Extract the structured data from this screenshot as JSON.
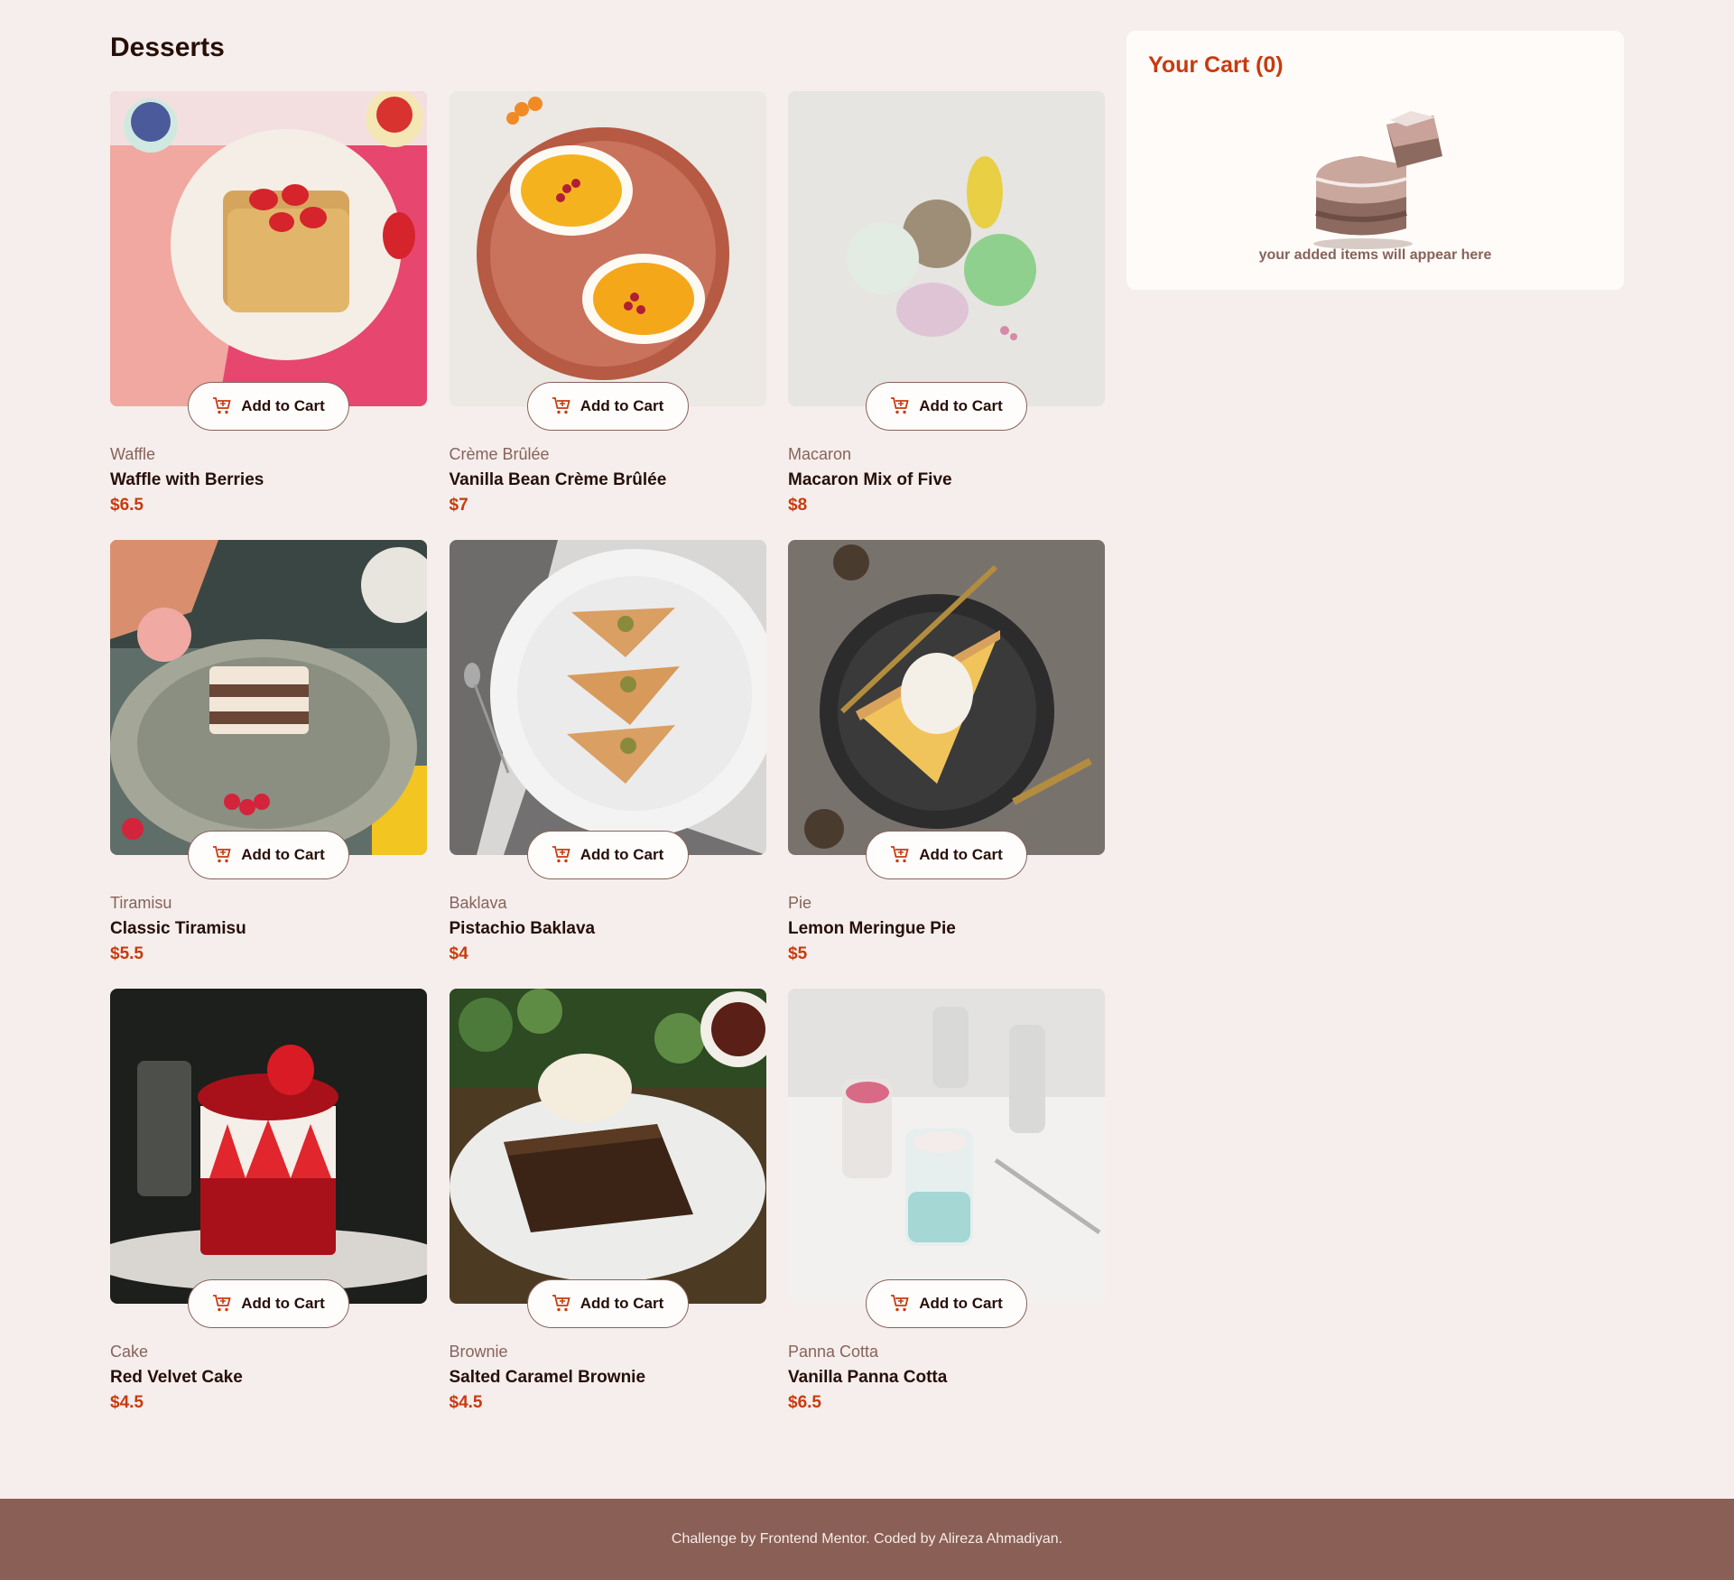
{
  "menu": {
    "title": "Desserts",
    "add_label": "Add to Cart",
    "products": [
      {
        "category": "Waffle",
        "name": "Waffle with Berries",
        "price": "$6.5"
      },
      {
        "category": "Crème Brûlée",
        "name": "Vanilla Bean Crème Brûlée",
        "price": "$7"
      },
      {
        "category": "Macaron",
        "name": "Macaron Mix of Five",
        "price": "$8"
      },
      {
        "category": "Tiramisu",
        "name": "Classic Tiramisu",
        "price": "$5.5"
      },
      {
        "category": "Baklava",
        "name": "Pistachio Baklava",
        "price": "$4"
      },
      {
        "category": "Pie",
        "name": "Lemon Meringue Pie",
        "price": "$5"
      },
      {
        "category": "Cake",
        "name": "Red Velvet Cake",
        "price": "$4.5"
      },
      {
        "category": "Brownie",
        "name": "Salted Caramel Brownie",
        "price": "$4.5"
      },
      {
        "category": "Panna Cotta",
        "name": "Vanilla Panna Cotta",
        "price": "$6.5"
      }
    ]
  },
  "cart": {
    "title": "Your Cart (0)",
    "empty_message": "your added items will appear here"
  },
  "footer": {
    "credit": "Challenge by Frontend Mentor. Coded by Alireza Ahmadiyan."
  },
  "colors": {
    "background": "#f5eeec",
    "accent": "#c73b0f",
    "muted": "#87635a",
    "footer": "#8a5f55"
  }
}
